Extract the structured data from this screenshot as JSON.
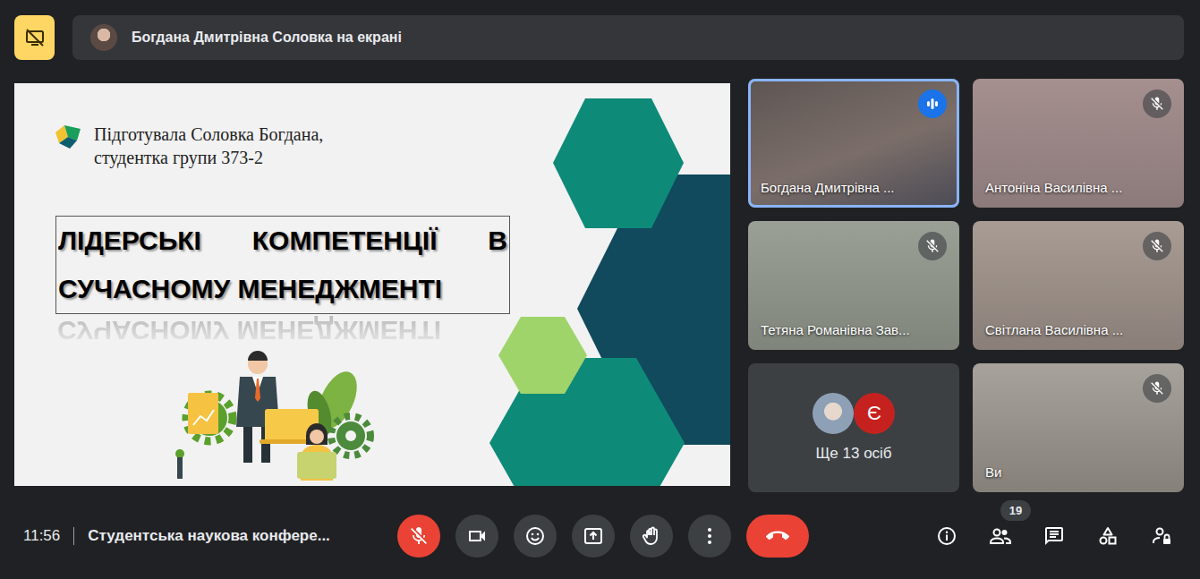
{
  "presenting_bar": {
    "text": "Богдана Дмитрівна Соловка на екрані"
  },
  "slide": {
    "author": "Підготувала Соловка Богдана,",
    "subtitle": "студентка групи 373-2",
    "title_lines": [
      "ЛІДЕРСЬКІ КОМПЕТЕНЦІЇ В",
      "СУЧАСНОМУ МЕНЕДЖМЕНТІ"
    ],
    "reflection": "СУЧАСНОМУ МЕНЕДЖМЕНТІ"
  },
  "tiles": [
    {
      "name": "Богдана Дмитрівна ...",
      "speaking": true,
      "muted": false
    },
    {
      "name": "Антоніна Василівна ...",
      "speaking": false,
      "muted": true
    },
    {
      "name": "Тетяна Романівна Зав...",
      "speaking": false,
      "muted": true
    },
    {
      "name": "Світлана Василівна ...",
      "speaking": false,
      "muted": true
    }
  ],
  "others": {
    "label": "Ще 13 осіб",
    "avatars": [
      {
        "kind": "photo"
      },
      {
        "kind": "letter",
        "letter": "Є",
        "color": "#c5221f"
      }
    ]
  },
  "self": {
    "name": "Ви",
    "speaking": false,
    "muted": true
  },
  "meeting": {
    "time": "11:56",
    "title": "Студентська наукова конфере..."
  },
  "controls": {
    "microphone_on": false,
    "camera_on": true
  },
  "participants_count": "19"
}
